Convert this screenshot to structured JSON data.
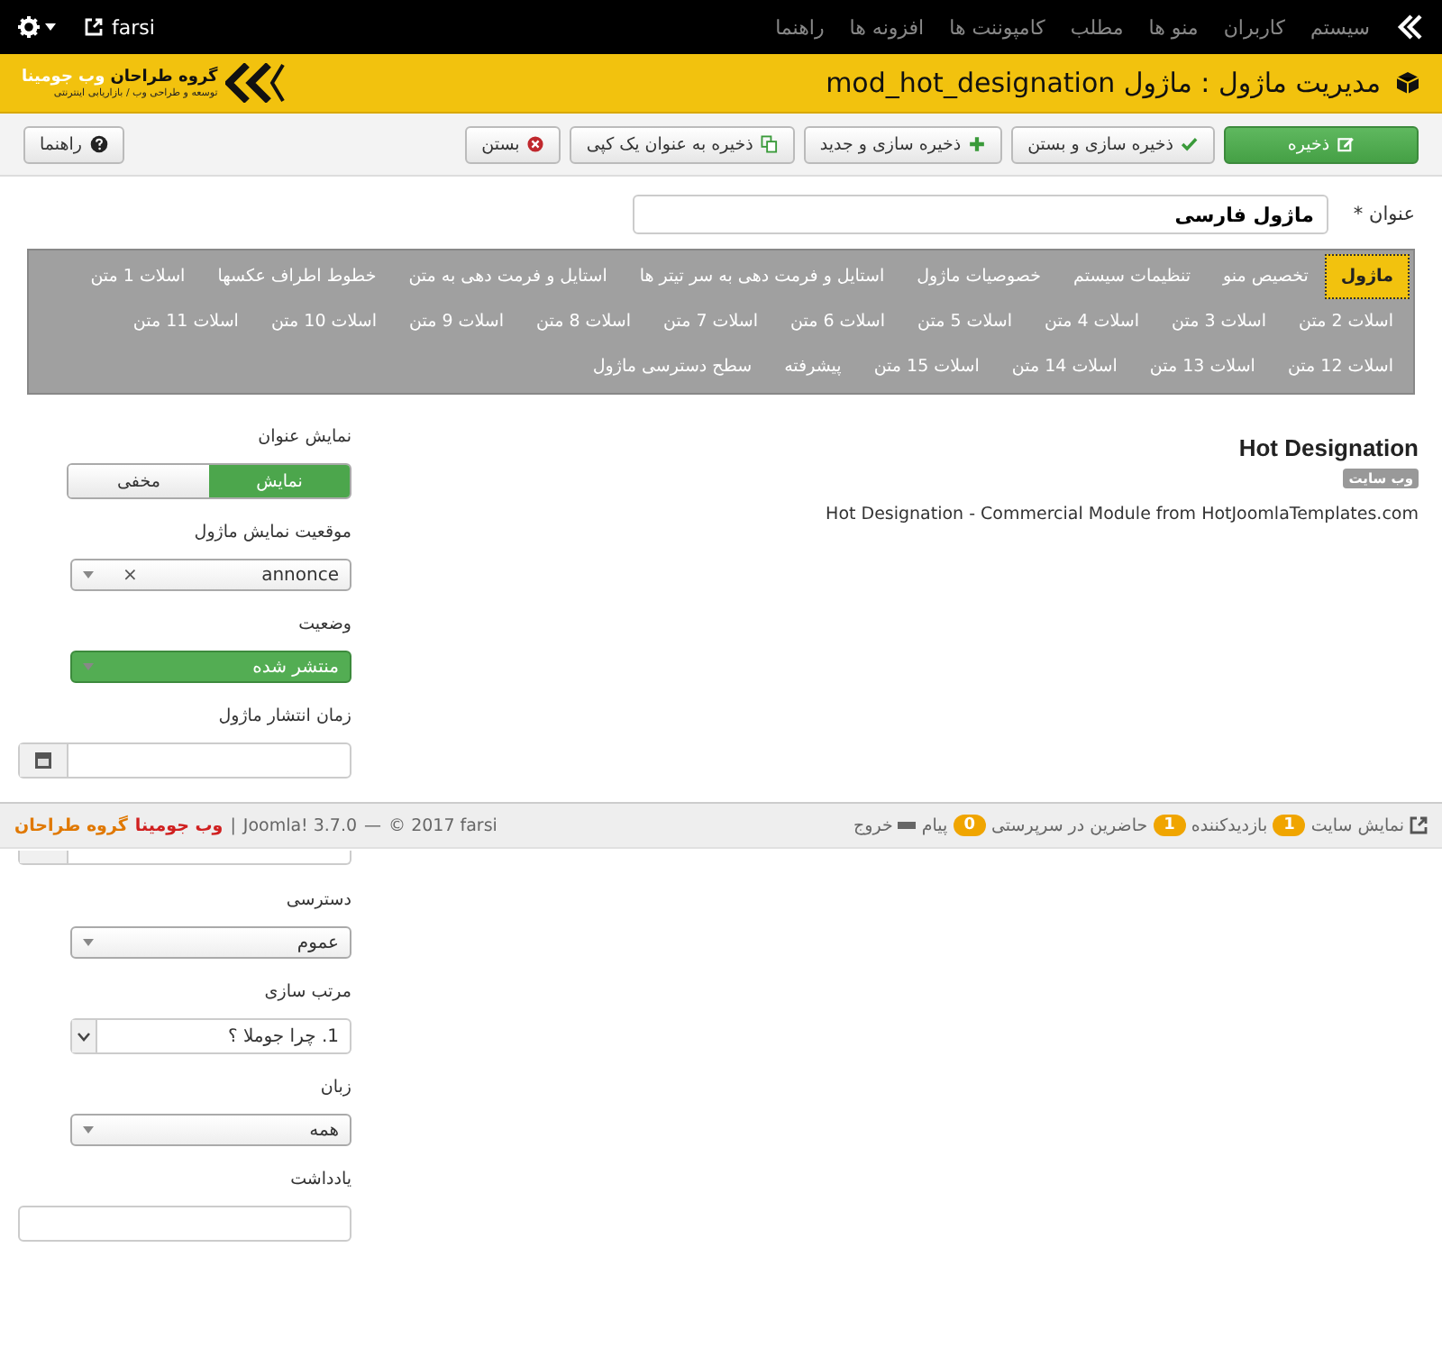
{
  "top_menu": {
    "items": [
      "سیستم",
      "کاربران",
      "منو ها",
      "مطلب",
      "کامپوننت ها",
      "افزونه ها",
      "راهنما"
    ],
    "user": "farsi"
  },
  "header": {
    "title": "مدیریت ماژول : ماژول mod_hot_designation",
    "logo_name": "گروه طراحان",
    "logo_brand": "وب جومینا",
    "logo_tagline": "توسعه و طراحی وب / بازاریابی اینترنتی"
  },
  "toolbar": {
    "buttons": [
      {
        "label": "ذخیره",
        "kind": "primary"
      },
      {
        "label": "ذخیره سازی و بستن",
        "kind": "default"
      },
      {
        "label": "ذخیره سازی و جدید",
        "kind": "default"
      },
      {
        "label": "ذخیره به عنوان یک کپی",
        "kind": "default"
      },
      {
        "label": "بستن",
        "kind": "default"
      }
    ],
    "help": "راهنما"
  },
  "title_field": {
    "label": "عنوان",
    "required_mark": "*",
    "value": "ماژول فارسی"
  },
  "tabs": [
    {
      "label": "ماژول",
      "selected": true
    },
    {
      "label": "تخصیص منو",
      "selected": false
    },
    {
      "label": "تنظیمات سیستم",
      "selected": false
    },
    {
      "label": "خصوصیات ماژول",
      "selected": false
    },
    {
      "label": "استایل و فرمت دهی به سر تیتر ها",
      "selected": false
    },
    {
      "label": "استایل و فرمت دهی به متن",
      "selected": false
    },
    {
      "label": "خطوط اطراف عکسها",
      "selected": false
    },
    {
      "label": "اسلات 1 متن",
      "selected": false
    },
    {
      "label": "اسلات 2 متن",
      "selected": false
    },
    {
      "label": "اسلات 3 متن",
      "selected": false
    },
    {
      "label": "اسلات 4 متن",
      "selected": false
    },
    {
      "label": "اسلات 5 متن",
      "selected": false
    },
    {
      "label": "اسلات 6 متن",
      "selected": false
    },
    {
      "label": "اسلات 7 متن",
      "selected": false
    },
    {
      "label": "اسلات 8 متن",
      "selected": false
    },
    {
      "label": "اسلات 9 متن",
      "selected": false
    },
    {
      "label": "اسلات 10 متن",
      "selected": false
    },
    {
      "label": "اسلات 11 متن",
      "selected": false
    },
    {
      "label": "اسلات 12 متن",
      "selected": false
    },
    {
      "label": "اسلات 13 متن",
      "selected": false
    },
    {
      "label": "اسلات 14 متن",
      "selected": false
    },
    {
      "label": "اسلات 15 متن",
      "selected": false
    },
    {
      "label": "پیشرفته",
      "selected": false
    },
    {
      "label": "سطح دسترسی ماژول",
      "selected": false
    }
  ],
  "preview": {
    "title": "Hot Designation",
    "badge": "وب سایت",
    "description": "Hot Designation - Commercial Module from HotJoomlaTemplates.com"
  },
  "fields": [
    {
      "kind": "toggle",
      "label": "نمایش عنوان",
      "options": [
        {
          "label": "نمایش",
          "selected": true
        },
        {
          "label": "مخفی",
          "selected": false
        }
      ]
    },
    {
      "kind": "select",
      "label": "موقعیت نمایش ماژول",
      "value": "annonce",
      "clear": "×"
    },
    {
      "kind": "status",
      "label": "وضعیت",
      "value": "منتشر شده"
    },
    {
      "kind": "date",
      "label": "زمان انتشار ماژول"
    },
    {
      "kind": "stub"
    },
    {
      "kind": "select",
      "label": "دسترسی",
      "value": "عموم"
    },
    {
      "kind": "ordering",
      "label": "مرتب سازی",
      "value": "1. چرا جوملا ؟"
    },
    {
      "kind": "select",
      "label": "زبان",
      "value": "همه"
    },
    {
      "kind": "text",
      "label": "یادداشت"
    }
  ],
  "status_bar": {
    "view_site": "نمایش سایت",
    "visitors_count": "1",
    "visitors": "بازدیدکننده",
    "admins_count": "1",
    "admins": "حاضرین در سرپرستی",
    "messages_count": "0",
    "messages": "پیام",
    "logout": "خروج",
    "copyright": "© 2017 farsi",
    "separator_1": "|",
    "separator_2": "—",
    "version": "Joomla! 3.7.0",
    "credit_name": "گروه طراحان",
    "credit_brand": "وب جومینا"
  }
}
